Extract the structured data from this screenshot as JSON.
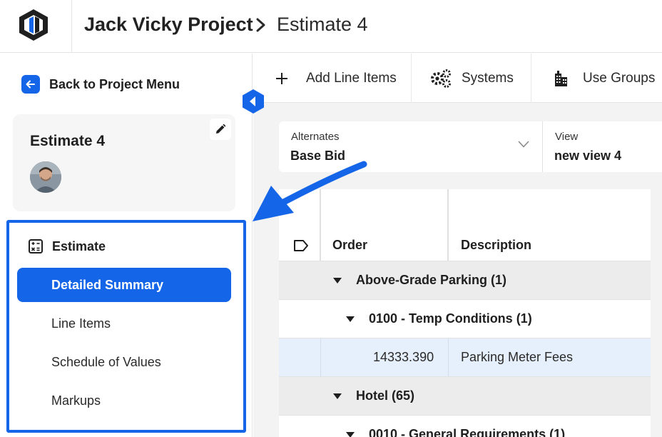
{
  "header": {
    "project_name": "Jack Vicky Project",
    "separator": ">",
    "current_page": "Estimate 4"
  },
  "sidebar": {
    "back_label": "Back to Project Menu",
    "estimate_card": {
      "title": "Estimate 4"
    },
    "section_label": "Estimate",
    "items": [
      {
        "label": "Detailed Summary",
        "active": true
      },
      {
        "label": "Line Items",
        "active": false
      },
      {
        "label": "Schedule of Values",
        "active": false
      },
      {
        "label": "Markups",
        "active": false
      }
    ]
  },
  "toolbar": {
    "add_line_items": "Add Line Items",
    "systems": "Systems",
    "use_groups": "Use Groups"
  },
  "selectors": {
    "alternates_label": "Alternates",
    "alternates_value": "Base Bid",
    "view_label": "View",
    "view_value": "new view 4"
  },
  "grid": {
    "columns": [
      "Order",
      "Description"
    ],
    "rows": [
      {
        "type": "group",
        "label": "Above-Grade Parking (1)"
      },
      {
        "type": "sub",
        "label": "0100 - Temp Conditions (1)"
      },
      {
        "type": "item",
        "order": "14333.390",
        "description": "Parking Meter Fees"
      },
      {
        "type": "group",
        "label": "Hotel (65)"
      },
      {
        "type": "sub",
        "label": "0010 - General Requirements (1)"
      }
    ]
  },
  "colors": {
    "accent": "#1565e8",
    "group_row": "#ececec",
    "selected_row": "#e6f0fc"
  },
  "icons": {
    "logo": "brand-logo-icon",
    "back": "arrow-left-icon",
    "collapse": "chevron-left-icon",
    "edit": "pencil-icon",
    "section": "calculator-icon",
    "add": "plus-icon",
    "systems": "gears-icon",
    "use_groups": "building-icon",
    "tag": "tag-icon"
  }
}
